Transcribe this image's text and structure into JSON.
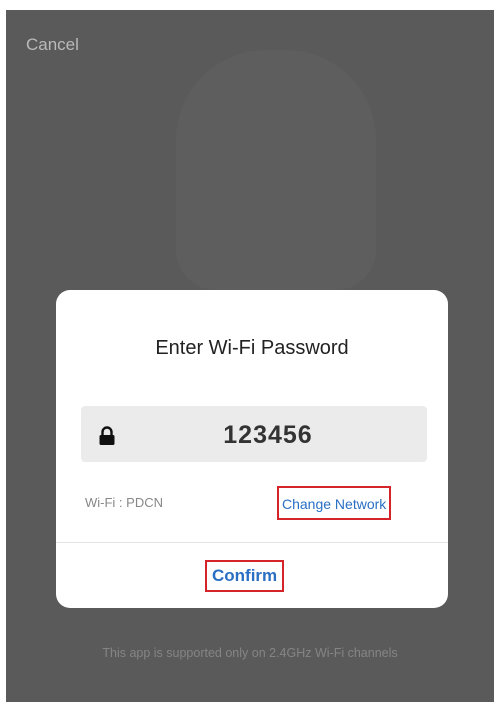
{
  "header": {
    "cancel_label": "Cancel"
  },
  "dialog": {
    "title": "Enter Wi-Fi Password",
    "password_value": "123456",
    "lock_icon": "lock-icon",
    "wifi_label": "Wi-Fi : PDCN",
    "change_network_label": "Change Network",
    "confirm_label": "Confirm"
  },
  "footer": {
    "note": "This app is supported only on 2.4GHz Wi-Fi channels"
  },
  "colors": {
    "overlay": "#5a5a5a",
    "link": "#2a6fc4",
    "highlight_border": "#d5232a",
    "field_bg": "#ebebeb"
  }
}
